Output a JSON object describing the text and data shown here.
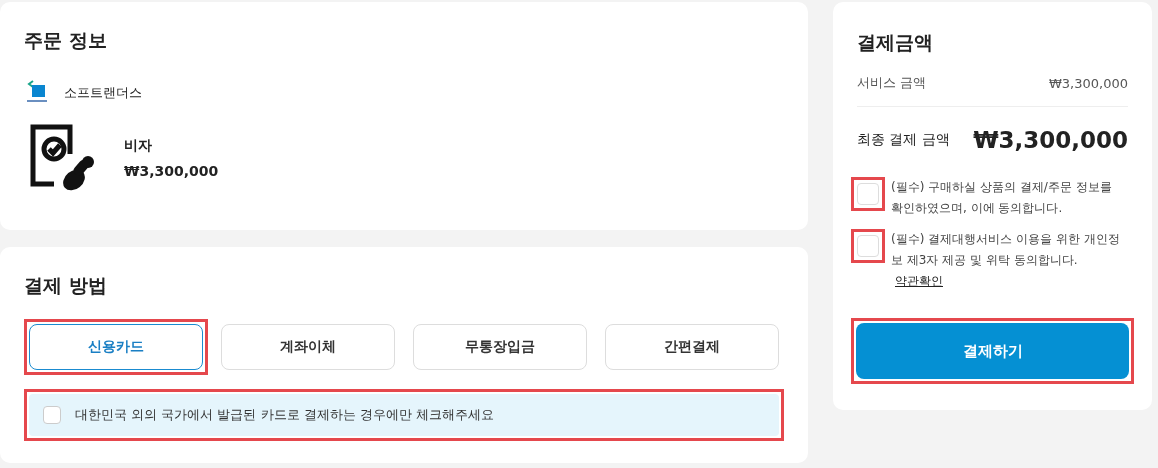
{
  "order": {
    "title": "주문 정보",
    "seller": "소프트랜더스",
    "product": {
      "name": "비자",
      "price": "₩3,300,000"
    }
  },
  "payment_method": {
    "title": "결제 방법",
    "options": [
      {
        "label": "신용카드",
        "selected": true,
        "highlighted": true
      },
      {
        "label": "계좌이체",
        "selected": false,
        "highlighted": false
      },
      {
        "label": "무통장입금",
        "selected": false,
        "highlighted": false
      },
      {
        "label": "간편결제",
        "selected": false,
        "highlighted": false
      }
    ],
    "foreign_card": {
      "label": "대한민국 외의 국가에서 발급된 카드로 결제하는 경우에만 체크해주세요",
      "checked": false,
      "highlighted": true
    }
  },
  "summary": {
    "title": "결제금액",
    "service_label": "서비스 금액",
    "service_amount": "₩3,300,000",
    "total_label": "최종 결제 금액",
    "total_amount": "₩3,300,000",
    "agreements": [
      {
        "text": "(필수) 구매하실 상품의 결제/주문 정보를 확인하였으며, 이에 동의합니다.",
        "checked": false,
        "highlighted": true
      },
      {
        "text": "(필수) 결제대행서비스 이용을 위한 개인정보 제3자 제공 및 위탁 동의합니다.",
        "checked": false,
        "highlighted": true,
        "link": "약관확인"
      }
    ],
    "pay_button": {
      "label": "결제하기",
      "highlighted": true
    }
  }
}
